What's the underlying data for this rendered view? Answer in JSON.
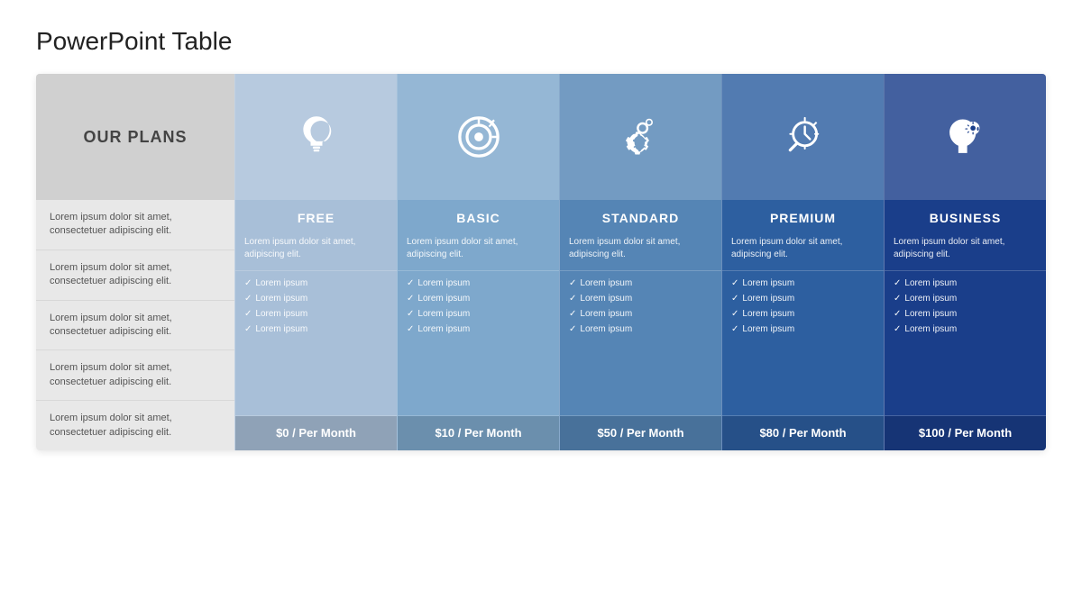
{
  "page": {
    "title": "PowerPoint Table"
  },
  "plans_label": "OUR PLANS",
  "label_rows": [
    "Lorem ipsum dolor sit amet, consectetuer adipiscing elit.",
    "Lorem ipsum dolor sit amet, consectetuer adipiscing elit.",
    "Lorem ipsum dolor sit amet, consectetuer adipiscing elit.",
    "Lorem ipsum dolor sit amet, consectetuer adipiscing elit.",
    "Lorem ipsum dolor sit amet, consectetuer adipiscing elit."
  ],
  "plans": [
    {
      "id": "free",
      "name": "FREE",
      "icon": "lightbulb",
      "desc": "Lorem ipsum dolor sit amet, adipiscing elit.",
      "features": [
        "Lorem ipsum",
        "Lorem ipsum",
        "Lorem ipsum",
        "Lorem ipsum"
      ],
      "price": "$0 / Per Month"
    },
    {
      "id": "basic",
      "name": "BASIC",
      "icon": "target",
      "desc": "Lorem ipsum dolor sit amet, adipiscing elit.",
      "features": [
        "Lorem ipsum",
        "Lorem ipsum",
        "Lorem ipsum",
        "Lorem ipsum"
      ],
      "price": "$10 / Per Month"
    },
    {
      "id": "standard",
      "name": "STANDARD",
      "icon": "gears",
      "desc": "Lorem ipsum dolor sit amet, adipiscing elit.",
      "features": [
        "Lorem ipsum",
        "Lorem ipsum",
        "Lorem ipsum",
        "Lorem ipsum"
      ],
      "price": "$50 / Per Month"
    },
    {
      "id": "premium",
      "name": "PREMIUM",
      "icon": "analytics",
      "desc": "Lorem ipsum dolor sit amet, adipiscing elit.",
      "features": [
        "Lorem ipsum",
        "Lorem ipsum",
        "Lorem ipsum",
        "Lorem ipsum"
      ],
      "price": "$80 / Per Month"
    },
    {
      "id": "business",
      "name": "BUSINESS",
      "icon": "brain",
      "desc": "Lorem ipsum dolor sit amet, adipiscing elit.",
      "features": [
        "Lorem ipsum",
        "Lorem ipsum",
        "Lorem ipsum",
        "Lorem ipsum"
      ],
      "price": "$100 / Per Month"
    }
  ]
}
